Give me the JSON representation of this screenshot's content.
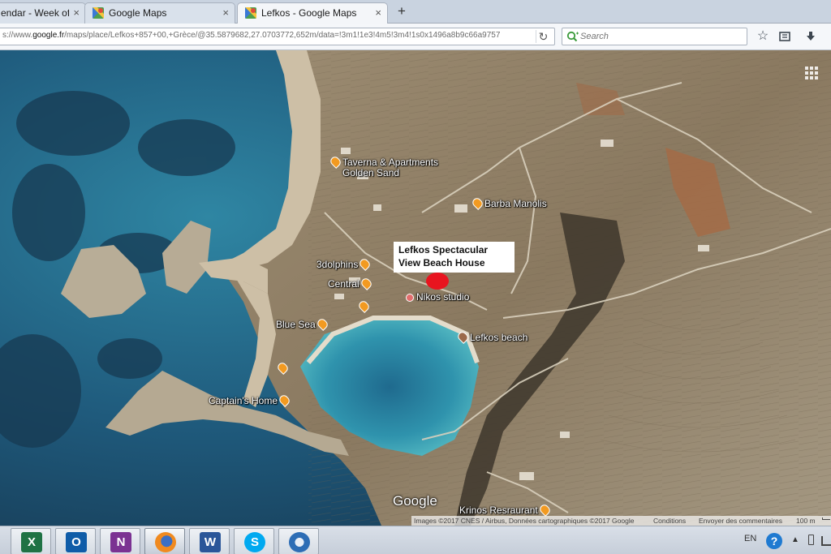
{
  "browser": {
    "tabs": [
      {
        "title": "endar - Week of J",
        "active": false
      },
      {
        "title": "Google Maps",
        "active": false
      },
      {
        "title": "Lefkos - Google Maps",
        "active": true
      }
    ],
    "close_glyph": "×",
    "new_tab_glyph": "+",
    "url_prefix": "s://www.",
    "url_host": "google.fr",
    "url_rest": "/maps/place/Lefkos+857+00,+Grèce/@35.5879682,27.0703772,652m/data=!3m1!1e3!4m5!3m4!1s0x1496a8b9c66a9757",
    "search_placeholder": "Search",
    "icons": [
      "reload-icon",
      "bookmark-star-icon",
      "reading-list-icon",
      "download-icon"
    ]
  },
  "map": {
    "pois": {
      "taverna_line1": "Taverna & Apartments",
      "taverna_line2": "Golden Sand",
      "barba_manolis": "Barba Manolis",
      "three_dolphins": "3dolphins",
      "central": "Central",
      "nikos_studio": "Nikos studio",
      "blue_sea": "Blue Sea",
      "lefkos_beach": "Lefkos beach",
      "captains_home": "Captain's Home",
      "krinos": "Krinos Resraurant"
    },
    "annotation": {
      "line1": "Lefkos Spectacular",
      "line2": "View Beach House"
    },
    "logo": "Google",
    "attribution": {
      "imagery": "Images ©2017 CNES / Airbus, Données cartographiques ©2017 Google",
      "terms": "Conditions",
      "feedback": "Envoyer des commentaires",
      "scale": "100 m"
    },
    "colors": {
      "deep_sea": "#1a4565",
      "shallow_sea": "#2f86a3",
      "beach_water": "#3fa7b8",
      "sand": "#cdbfa6",
      "land": "#8d7c63",
      "marker": "#e8141f",
      "poi_pin": "#f29a21"
    }
  },
  "taskbar": {
    "apps": [
      {
        "name": "excel",
        "glyph": "X",
        "color": "#1f7244"
      },
      {
        "name": "outlook",
        "glyph": "O",
        "color": "#0f5ca8"
      },
      {
        "name": "onenote",
        "glyph": "N",
        "color": "#7b3292"
      },
      {
        "name": "firefox",
        "glyph": "",
        "color": "#e36a1e"
      },
      {
        "name": "word",
        "glyph": "W",
        "color": "#2a5699"
      },
      {
        "name": "skype",
        "glyph": "S",
        "color": "#00a9f0"
      },
      {
        "name": "thunderbird",
        "glyph": "",
        "color": "#2d6db5"
      }
    ],
    "language": "EN",
    "help_glyph": "?"
  }
}
